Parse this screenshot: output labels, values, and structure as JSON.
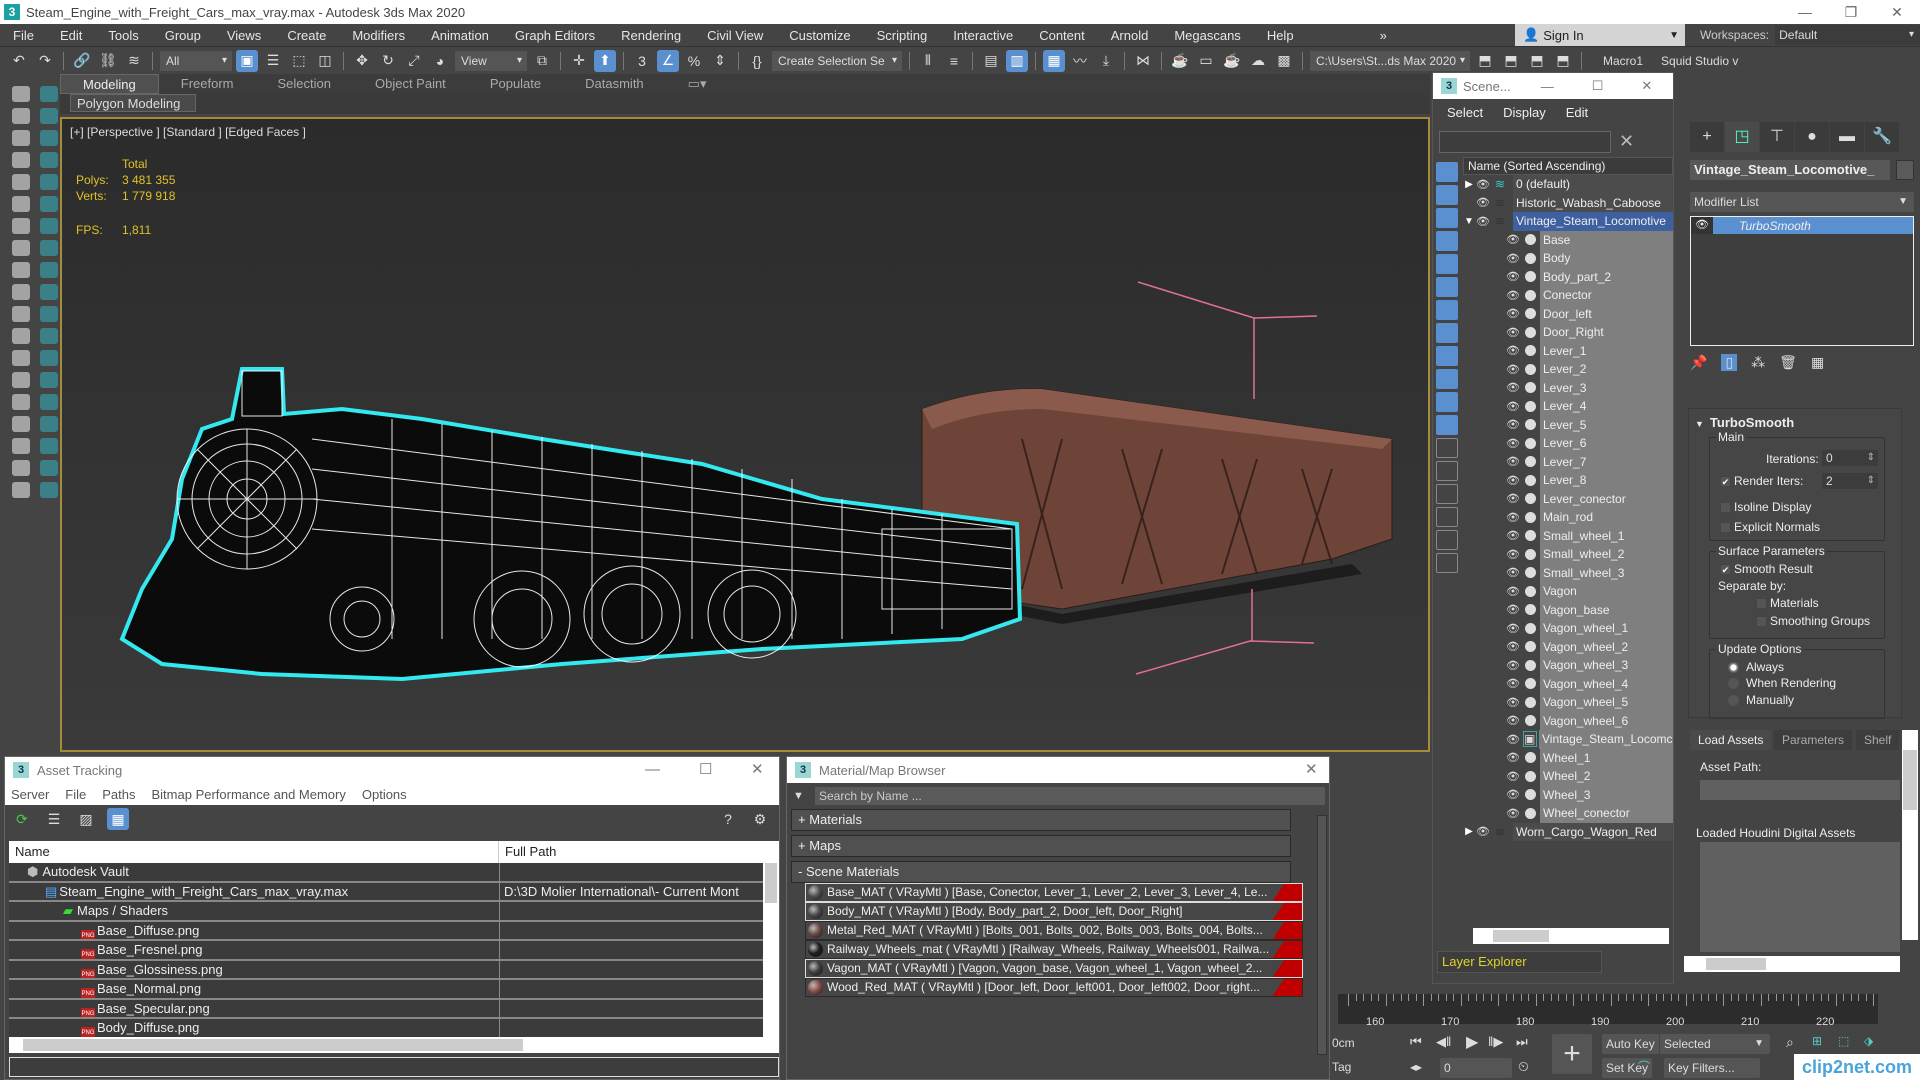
{
  "window": {
    "title": "Steam_Engine_with_Freight_Cars_max_vray.max - Autodesk 3ds Max 2020",
    "app_icon": "3ds-max-logo-icon",
    "controls": [
      "minimize-icon",
      "restore-icon",
      "close-icon"
    ]
  },
  "menubar": {
    "items": [
      "File",
      "Edit",
      "Tools",
      "Group",
      "Views",
      "Create",
      "Modifiers",
      "Animation",
      "Graph Editors",
      "Rendering",
      "Civil View",
      "Customize",
      "Scripting",
      "Interactive",
      "Content",
      "Arnold",
      "Megascans",
      "Help"
    ],
    "overflow": "»",
    "signin": "Sign In",
    "workspaces_label": "Workspaces:",
    "workspaces_value": "Default"
  },
  "toolbar": {
    "selection_filter": "All",
    "reference_coord": "View",
    "named_selection": "Create Selection Se",
    "project_path": "C:\\Users\\St...ds Max 2020",
    "macro1": "Macro1",
    "squid": "Squid Studio v"
  },
  "ribbon": {
    "tabs": [
      "Modeling",
      "Freeform",
      "Selection",
      "Object Paint",
      "Populate",
      "Datasmith"
    ],
    "active_tab": "Modeling",
    "panel_label": "Polygon Modeling"
  },
  "viewport": {
    "label": "[+] [Perspective ] [Standard ] [Edged Faces ]",
    "stats": {
      "header": "Total",
      "polys_label": "Polys:",
      "polys": "3 481 355",
      "verts_label": "Verts:",
      "verts": "1 779 918",
      "fps_label": "FPS:",
      "fps": "1,811"
    },
    "selection_color": "#34e8f0",
    "gizmo_color": "#e06fa0"
  },
  "scene_explorer": {
    "title": "Scene...",
    "menu": [
      "Select",
      "Display",
      "Edit"
    ],
    "column_header": "Name (Sorted Ascending)",
    "layers": [
      {
        "name": "0 (default)",
        "expanded": false
      },
      {
        "name": "Historic_Wabash_Caboose",
        "expanded": null
      },
      {
        "name": "Vintage_Steam_Locomotive",
        "expanded": true,
        "selected": true
      }
    ],
    "objects": [
      "Base",
      "Body",
      "Body_part_2",
      "Conector",
      "Door_left",
      "Door_Right",
      "Lever_1",
      "Lever_2",
      "Lever_3",
      "Lever_4",
      "Lever_5",
      "Lever_6",
      "Lever_7",
      "Lever_8",
      "Lever_conector",
      "Main_rod",
      "Small_wheel_1",
      "Small_wheel_2",
      "Small_wheel_3",
      "Vagon",
      "Vagon_base",
      "Vagon_wheel_1",
      "Vagon_wheel_2",
      "Vagon_wheel_3",
      "Vagon_wheel_4",
      "Vagon_wheel_5",
      "Vagon_wheel_6",
      "Vintage_Steam_Locomc",
      "Wheel_1",
      "Wheel_2",
      "Wheel_3",
      "Wheel_conector"
    ],
    "last_layer": "Worn_Cargo_Wagon_Red",
    "explorer_mode": "Layer Explorer"
  },
  "command_panel": {
    "object_name": "Vintage_Steam_Locomotive_",
    "modifier_list": "Modifier List",
    "modifier_stack": [
      "TurboSmooth"
    ],
    "rollout": {
      "title": "TurboSmooth",
      "main_group": "Main",
      "iterations_label": "Iterations:",
      "iterations": "0",
      "render_iters_label": "Render Iters:",
      "render_iters": "2",
      "render_iters_checked": true,
      "isoline_display": "Isoline Display",
      "isoline_checked": false,
      "explicit_normals": "Explicit Normals",
      "explicit_checked": false,
      "surface_group": "Surface Parameters",
      "smooth_result": "Smooth Result",
      "smooth_checked": true,
      "separate_by": "Separate by:",
      "materials": "Materials",
      "materials_checked": false,
      "smoothing_groups": "Smoothing Groups",
      "smoothing_checked": false,
      "update_group": "Update Options",
      "update_options": [
        "Always",
        "When Rendering",
        "Manually"
      ],
      "update_selected": "Always"
    }
  },
  "houdini": {
    "tabs": [
      "Load Assets",
      "Parameters",
      "Shelf"
    ],
    "active_tab": "Load Assets",
    "asset_path_label": "Asset Path:",
    "loaded_label": "Loaded Houdini Digital Assets"
  },
  "asset_tracking": {
    "title": "Asset Tracking",
    "menu": [
      "Server",
      "File",
      "Paths",
      "Bitmap Performance and Memory",
      "Options"
    ],
    "columns": [
      "Name",
      "Full Path"
    ],
    "rows": [
      {
        "name": "Autodesk Vault",
        "path": "",
        "indent": 1,
        "icon": "vault-icon"
      },
      {
        "name": "Steam_Engine_with_Freight_Cars_max_vray.max",
        "path": "D:\\3D Molier International\\- Current Mont",
        "indent": 2,
        "icon": "max-file-icon"
      },
      {
        "name": "Maps / Shaders",
        "path": "",
        "indent": 3,
        "icon": "maps-icon"
      },
      {
        "name": "Base_Diffuse.png",
        "path": "",
        "indent": 4,
        "icon": "png-icon"
      },
      {
        "name": "Base_Fresnel.png",
        "path": "",
        "indent": 4,
        "icon": "png-icon"
      },
      {
        "name": "Base_Glossiness.png",
        "path": "",
        "indent": 4,
        "icon": "png-icon"
      },
      {
        "name": "Base_Normal.png",
        "path": "",
        "indent": 4,
        "icon": "png-icon"
      },
      {
        "name": "Base_Specular.png",
        "path": "",
        "indent": 4,
        "icon": "png-icon"
      },
      {
        "name": "Body_Diffuse.png",
        "path": "",
        "indent": 4,
        "icon": "png-icon"
      }
    ]
  },
  "material_browser": {
    "title": "Material/Map Browser",
    "search_placeholder": "Search by Name ...",
    "groups": [
      "+ Materials",
      "+ Maps",
      "- Scene Materials"
    ],
    "materials": [
      {
        "text": "Base_MAT  ( VRayMtl )  [Base, Conector, Lever_1, Lever_2, Lever_3, Lever_4, Le...",
        "color": "#505050",
        "highlight": true
      },
      {
        "text": "Body_MAT  ( VRayMtl ) [Body, Body_part_2, Door_left, Door_Right]",
        "color": "#4a4a4a",
        "highlight": true
      },
      {
        "text": "Metal_Red_MAT  ( VRayMtl ) [Bolts_001, Bolts_002, Bolts_003, Bolts_004, Bolts...",
        "color": "#6a4a44",
        "highlight": false
      },
      {
        "text": "Railway_Wheels_mat  ( VRayMtl )  [Railway_Wheels, Railway_Wheels001, Railwa...",
        "color": "#1e1e1e",
        "highlight": false
      },
      {
        "text": "Vagon_MAT  ( VRayMtl )  [Vagon, Vagon_base, Vagon_wheel_1, Vagon_wheel_2...",
        "color": "#3e3e3e",
        "highlight": true
      },
      {
        "text": "Wood_Red_MAT  ( VRayMtl ) [Door_left, Door_left001, Door_left002, Door_right...",
        "color": "#8a5048",
        "highlight": false
      }
    ]
  },
  "timeline": {
    "ticks": [
      "160",
      "170",
      "180",
      "190",
      "200",
      "210",
      "220"
    ],
    "units": "0cm",
    "tag": "Tag",
    "frame": "0",
    "auto_key": "Auto Key",
    "set_key": "Set Key",
    "key_mode": "Selected",
    "key_filters": "Key Filters..."
  },
  "watermark": "clip2net.com"
}
